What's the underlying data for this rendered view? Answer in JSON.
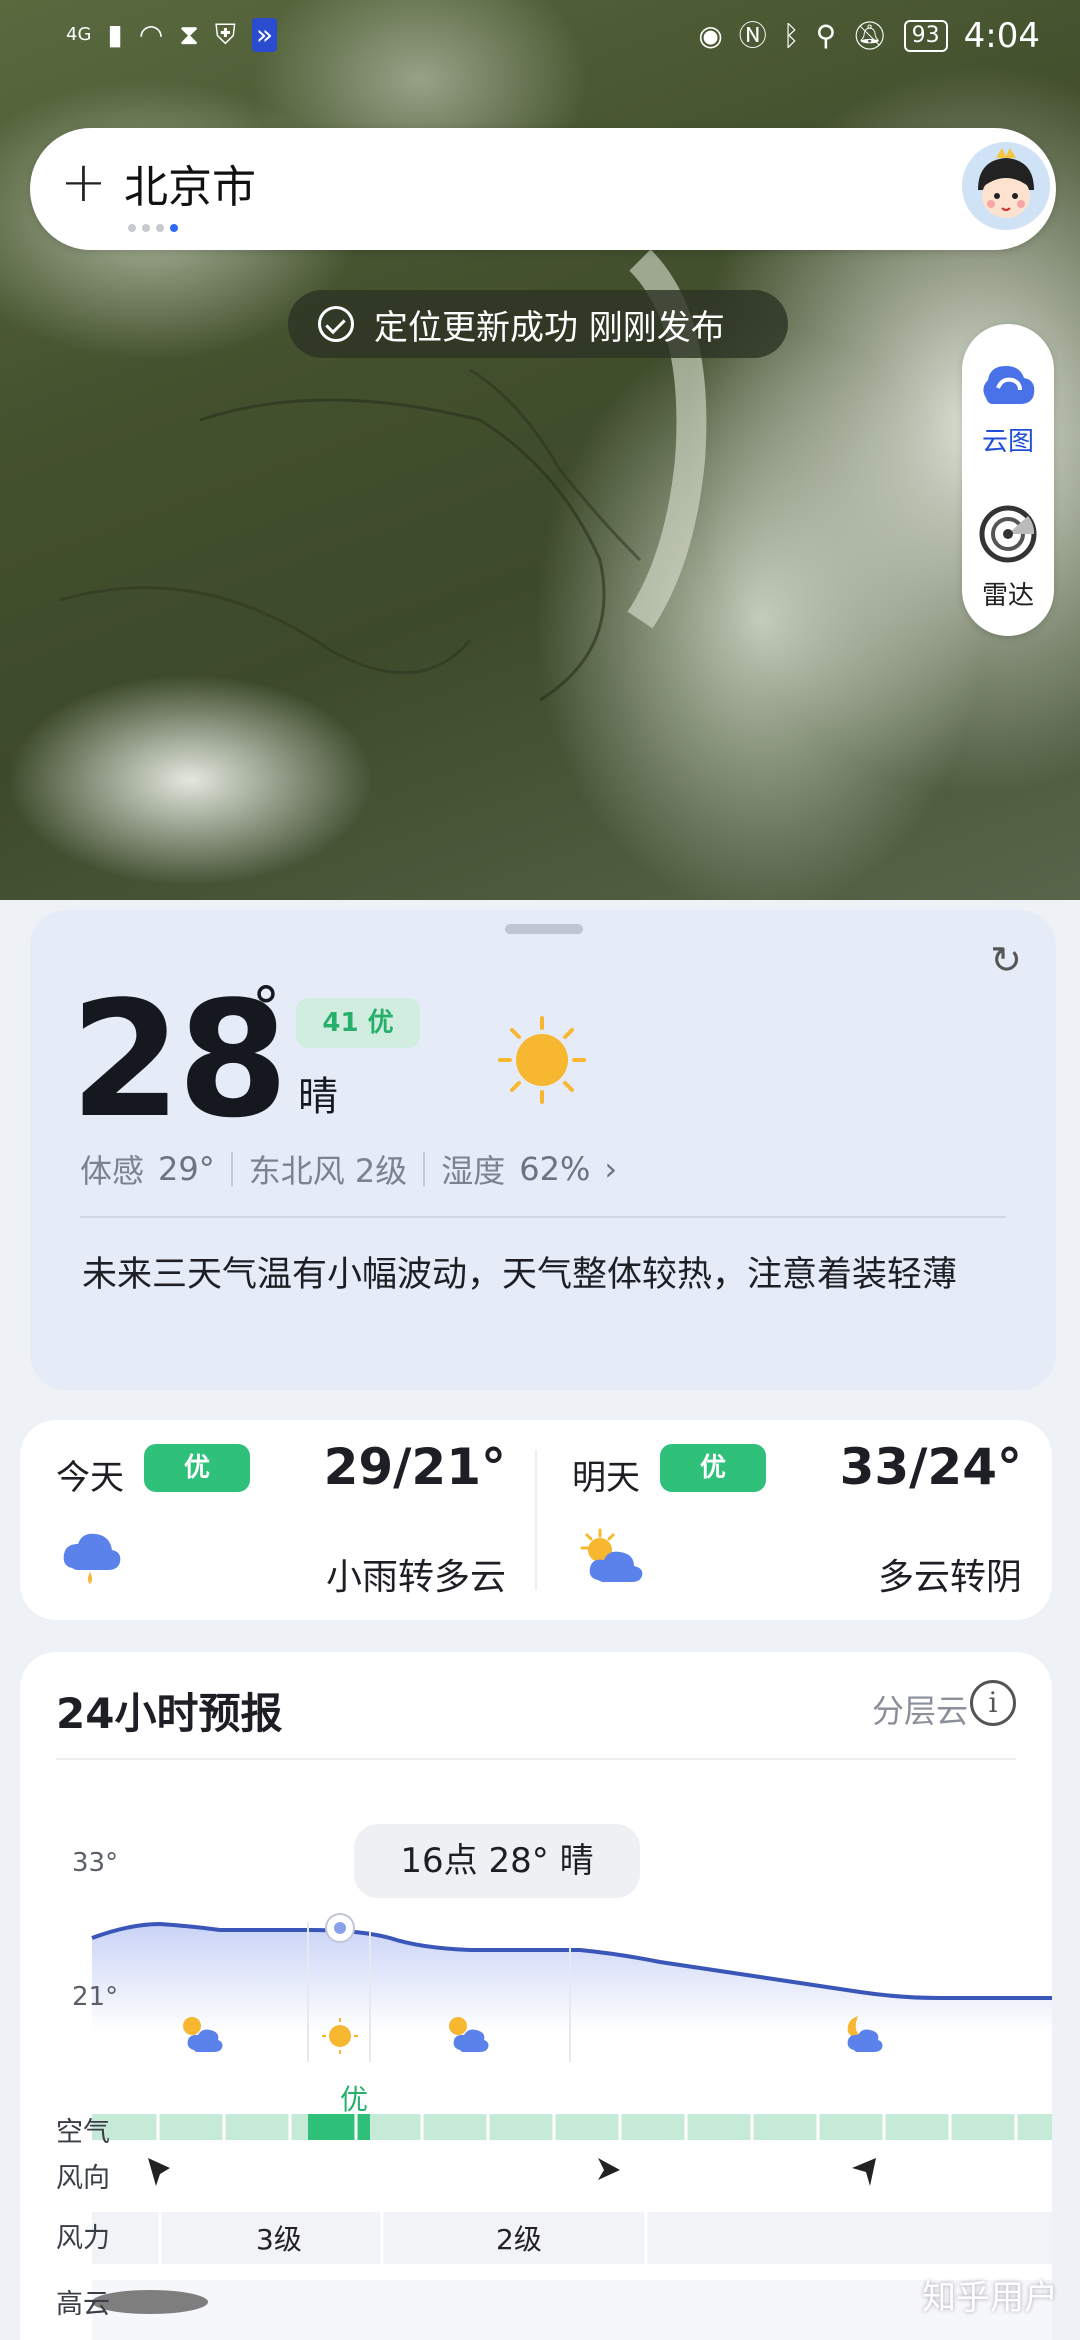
{
  "status_bar": {
    "network": "4G",
    "battery": "93",
    "time": "4:04"
  },
  "location": {
    "city": "北京市",
    "page_count": 4,
    "active_page": 4
  },
  "toast": {
    "text": "定位更新成功 刚刚发布"
  },
  "side_panel": {
    "cloud_label": "云图",
    "radar_label": "雷达"
  },
  "current": {
    "temperature": "28",
    "degree_symbol": "°",
    "aqi": "41 优",
    "condition": "晴",
    "feels_like_label": "体感",
    "feels_like": "29°",
    "wind": "东北风 2级",
    "humidity_label": "湿度",
    "humidity": "62%",
    "chevron": "›",
    "summary": "未来三天气温有小幅波动，天气整体较热，注意着装轻薄"
  },
  "days": [
    {
      "label": "今天",
      "aqi": "优",
      "range": "29/21°",
      "condition": "小雨转多云",
      "icon": "rain-cloud-icon"
    },
    {
      "label": "明天",
      "aqi": "优",
      "range": "33/24°",
      "condition": "多云转阴",
      "icon": "partly-cloudy-icon"
    }
  ],
  "forecast": {
    "title": "24小时预报",
    "layer_label": "分层云",
    "info": "i",
    "tooltip": "16点 28° 晴",
    "y_max": "33°",
    "y_min": "21°",
    "selected_aqi": "优",
    "row_labels": {
      "air": "空气",
      "wind_dir": "风向",
      "wind_force": "风力",
      "high_cloud": "高云"
    },
    "wind_levels": [
      "3级",
      "2级"
    ]
  },
  "watermark": "知乎用户",
  "colors": {
    "accent_blue": "#2a6df4",
    "aqi_green": "#2fc07a",
    "line_blue": "#3a56b8",
    "sun": "#f7b731"
  }
}
